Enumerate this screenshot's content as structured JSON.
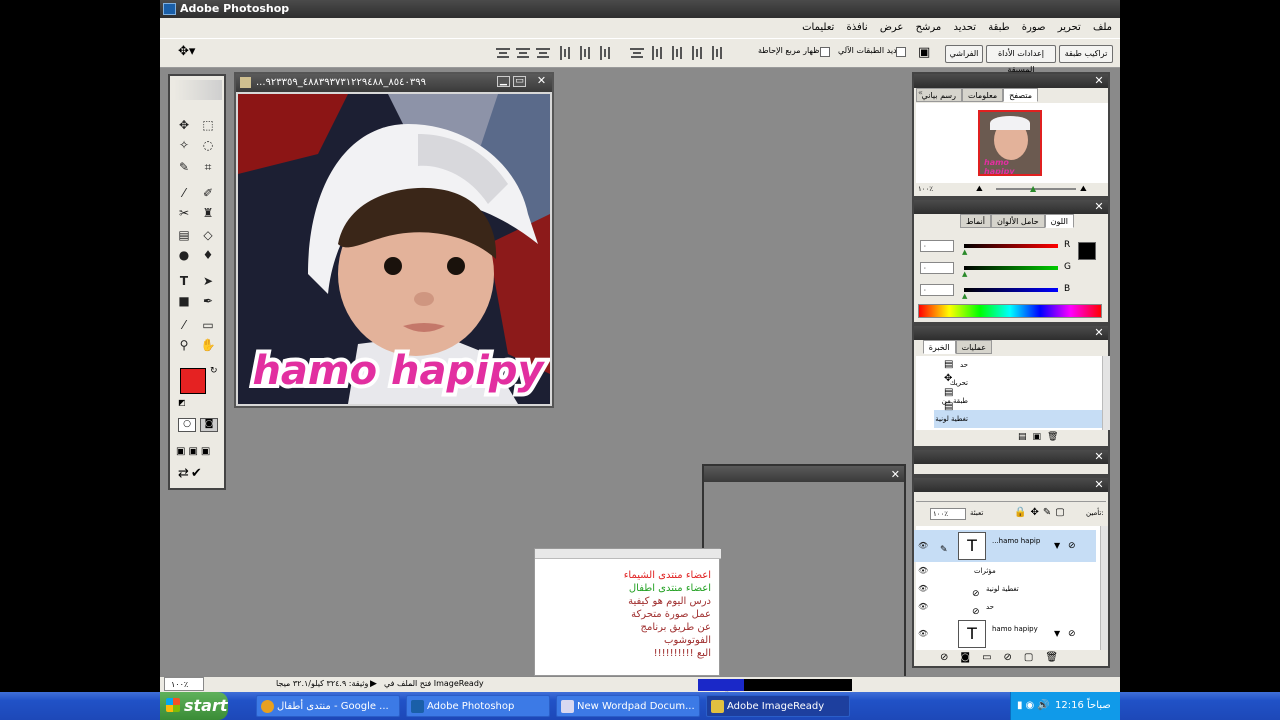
{
  "app": {
    "title": "Adobe Photoshop"
  },
  "menu": [
    "ملف",
    "تحرير",
    "صورة",
    "طبقة",
    "تحديد",
    "مرشح",
    "عرض",
    "نافذة",
    "تعليمات"
  ],
  "options_bar": {
    "tab_right": "تراكيب طبقة",
    "tab_presets": "إعدادات الأداة المسبقة",
    "tab_brushes": "الفراشي",
    "auto_select_label": "تحديد الطبقات الآلي",
    "show_bounding_label": "إظهار مربع الإحاطة"
  },
  "document": {
    "title": "...٨٥٤٠٣٩٩_٤٨٨٣٩٣٧٣١٢٢٩٤٨٨_٩٢٣٣٥٩",
    "overlay_text": "hamo hapipy"
  },
  "navigator": {
    "tabs": [
      "متصفح",
      "معلومات",
      "رسم بياني"
    ],
    "zoom": "١٠٠٪"
  },
  "color_panel": {
    "tabs": [
      "اللون",
      "حامل الألوان",
      "أنماط"
    ],
    "channels": [
      {
        "label": "R",
        "value": "٠"
      },
      {
        "label": "G",
        "value": "٠"
      },
      {
        "label": "B",
        "value": "٠"
      }
    ]
  },
  "history": {
    "tabs": [
      "عمليات",
      "الخبرة"
    ],
    "items": [
      "حد",
      "تحريك",
      "طبقة من خلال النسخ",
      "تغطية لونية"
    ]
  },
  "layers": {
    "opacity_label": "تعبئة",
    "opacity_value": "١٠٠٪",
    "lock_label": "تأمين:",
    "rows": [
      {
        "name": "...hamo hapip",
        "type": "T"
      },
      {
        "name": "مؤثرات",
        "type": ""
      },
      {
        "name": "تغطية لونية",
        "type": ""
      },
      {
        "name": "حد",
        "type": ""
      },
      {
        "name": "hamo hapipy",
        "type": "T"
      }
    ]
  },
  "wordpad_preview": {
    "lines": [
      "اعضاء منتدى الشيماء",
      "اعضاء منتدى اطفال",
      "درس اليوم هو كيفية",
      "عمل صورة متحركة",
      "عن طريق برنامج",
      "الفوتوشوب",
      "البع !!!!!!!!!!"
    ]
  },
  "status_bar": {
    "zoom": "١٠٠٪",
    "doc_info": "وثيقة: ٣٢٤.٩ كيلو/٣٢.١ ميجا",
    "ready_text": "فتح الملف في ImageReady"
  },
  "taskbar": {
    "start_label": "start",
    "tasks": [
      {
        "label": "منتدى أطفال - Google ...",
        "icon_color": "#e8a020"
      },
      {
        "label": "Adobe Photoshop",
        "icon_color": "#1a5fa8"
      },
      {
        "label": "New Wordpad Docum...",
        "icon_color": "#d8d8f0"
      },
      {
        "label": "Adobe ImageReady",
        "icon_color": "#e0c040"
      }
    ],
    "clock": "12:16",
    "clock_suffix": "صباحاً"
  },
  "colors": {
    "foreground": "#e52222",
    "background": "#ffffff",
    "workspace": "#8a8a8a",
    "panel": "#eceae3"
  }
}
